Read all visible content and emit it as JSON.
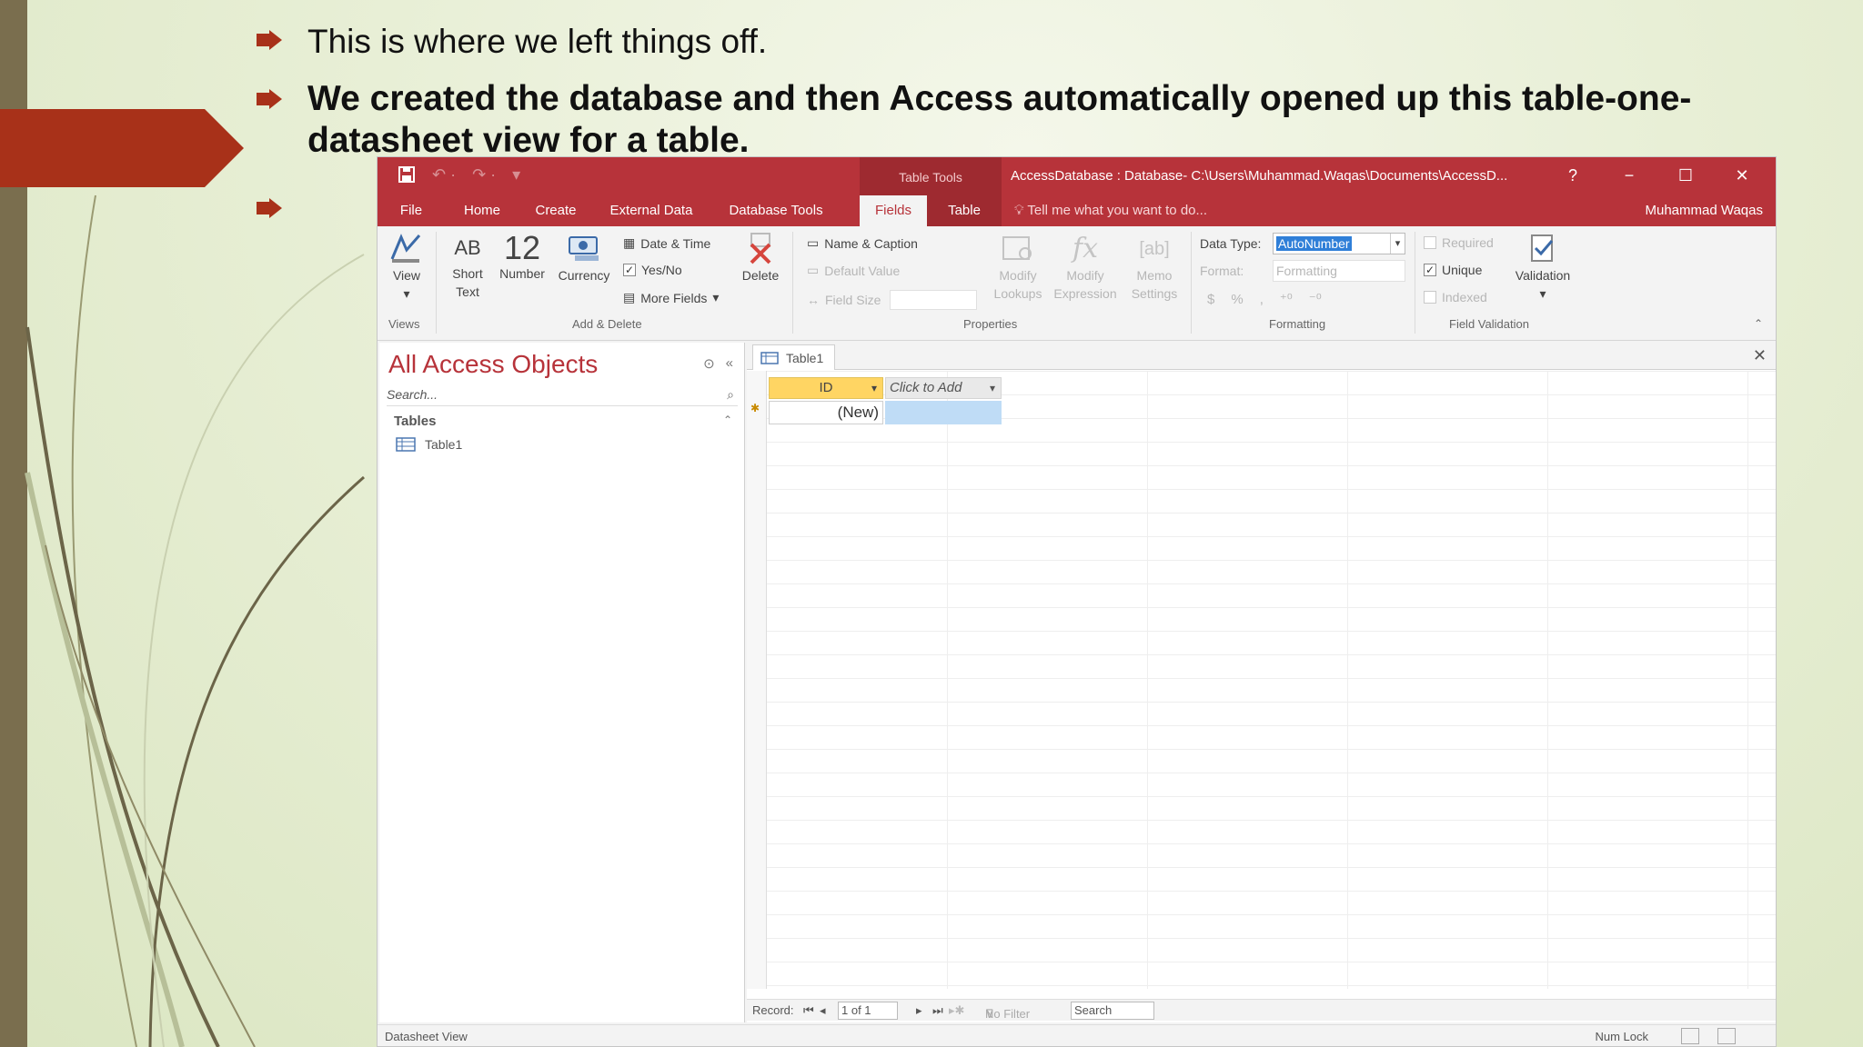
{
  "slide": {
    "bullets": [
      "This is where we left things off.",
      "We created the database and then Access automatically opened up this table-one-datasheet view for a table.",
      ""
    ],
    "colors": {
      "accent": "#a83119",
      "side_bar": "#7a6e4e",
      "bullet_marker": "#a83119"
    }
  },
  "window": {
    "title": "AccessDatabase : Database- C:\\Users\\Muhammad.Waqas\\Documents\\AccessD...",
    "context_tab": "Table Tools",
    "controls": [
      "?",
      "−",
      "☐",
      "✕"
    ],
    "qat": [
      "save-icon",
      "undo-icon",
      "redo-icon",
      "customize-icon"
    ],
    "tabs": [
      "File",
      "Home",
      "Create",
      "External Data",
      "Database Tools",
      "Fields",
      "Table"
    ],
    "active_tab": "Fields",
    "tell_me": "Tell me what you want to do...",
    "user": "Muhammad Waqas"
  },
  "ribbon": {
    "views": {
      "view": "View",
      "group": "Views"
    },
    "add_delete": {
      "short_text_glyph": "AB",
      "short_text_line1": "Short",
      "short_text_line2": "Text",
      "number_glyph": "12",
      "number": "Number",
      "currency": "Currency",
      "date_time": "Date & Time",
      "yes_no": "Yes/No",
      "more_fields": "More Fields",
      "delete": "Delete",
      "group": "Add & Delete"
    },
    "properties": {
      "name_caption": "Name & Caption",
      "default_value": "Default Value",
      "field_size": "Field Size",
      "modify_lookups_1": "Modify",
      "modify_lookups_2": "Lookups",
      "modify_expression_1": "Modify",
      "modify_expression_2": "Expression",
      "memo_settings_1": "Memo",
      "memo_settings_2": "Settings",
      "group": "Properties"
    },
    "formatting": {
      "data_type_label": "Data Type:",
      "data_type_value": "AutoNumber",
      "format_label": "Format:",
      "format_value": "Formatting",
      "currency_symbol": "$",
      "percent_symbol": "%",
      "comma_symbol": ",",
      "group": "Formatting"
    },
    "field_validation": {
      "required": "Required",
      "unique": "Unique",
      "indexed": "Indexed",
      "validation": "Validation",
      "group": "Field Validation",
      "unique_checked": true
    }
  },
  "nav_pane": {
    "title": "All Access Objects",
    "search_placeholder": "Search...",
    "category": "Tables",
    "items": [
      "Table1"
    ]
  },
  "datasheet": {
    "tab": "Table1",
    "columns": [
      "ID",
      "Click to Add"
    ],
    "new_row": "(New)",
    "record_nav": {
      "label": "Record:",
      "position": "1 of 1",
      "filter": "No Filter",
      "search": "Search"
    }
  },
  "status_bar": {
    "left": "Datasheet View",
    "right": "Num Lock"
  }
}
